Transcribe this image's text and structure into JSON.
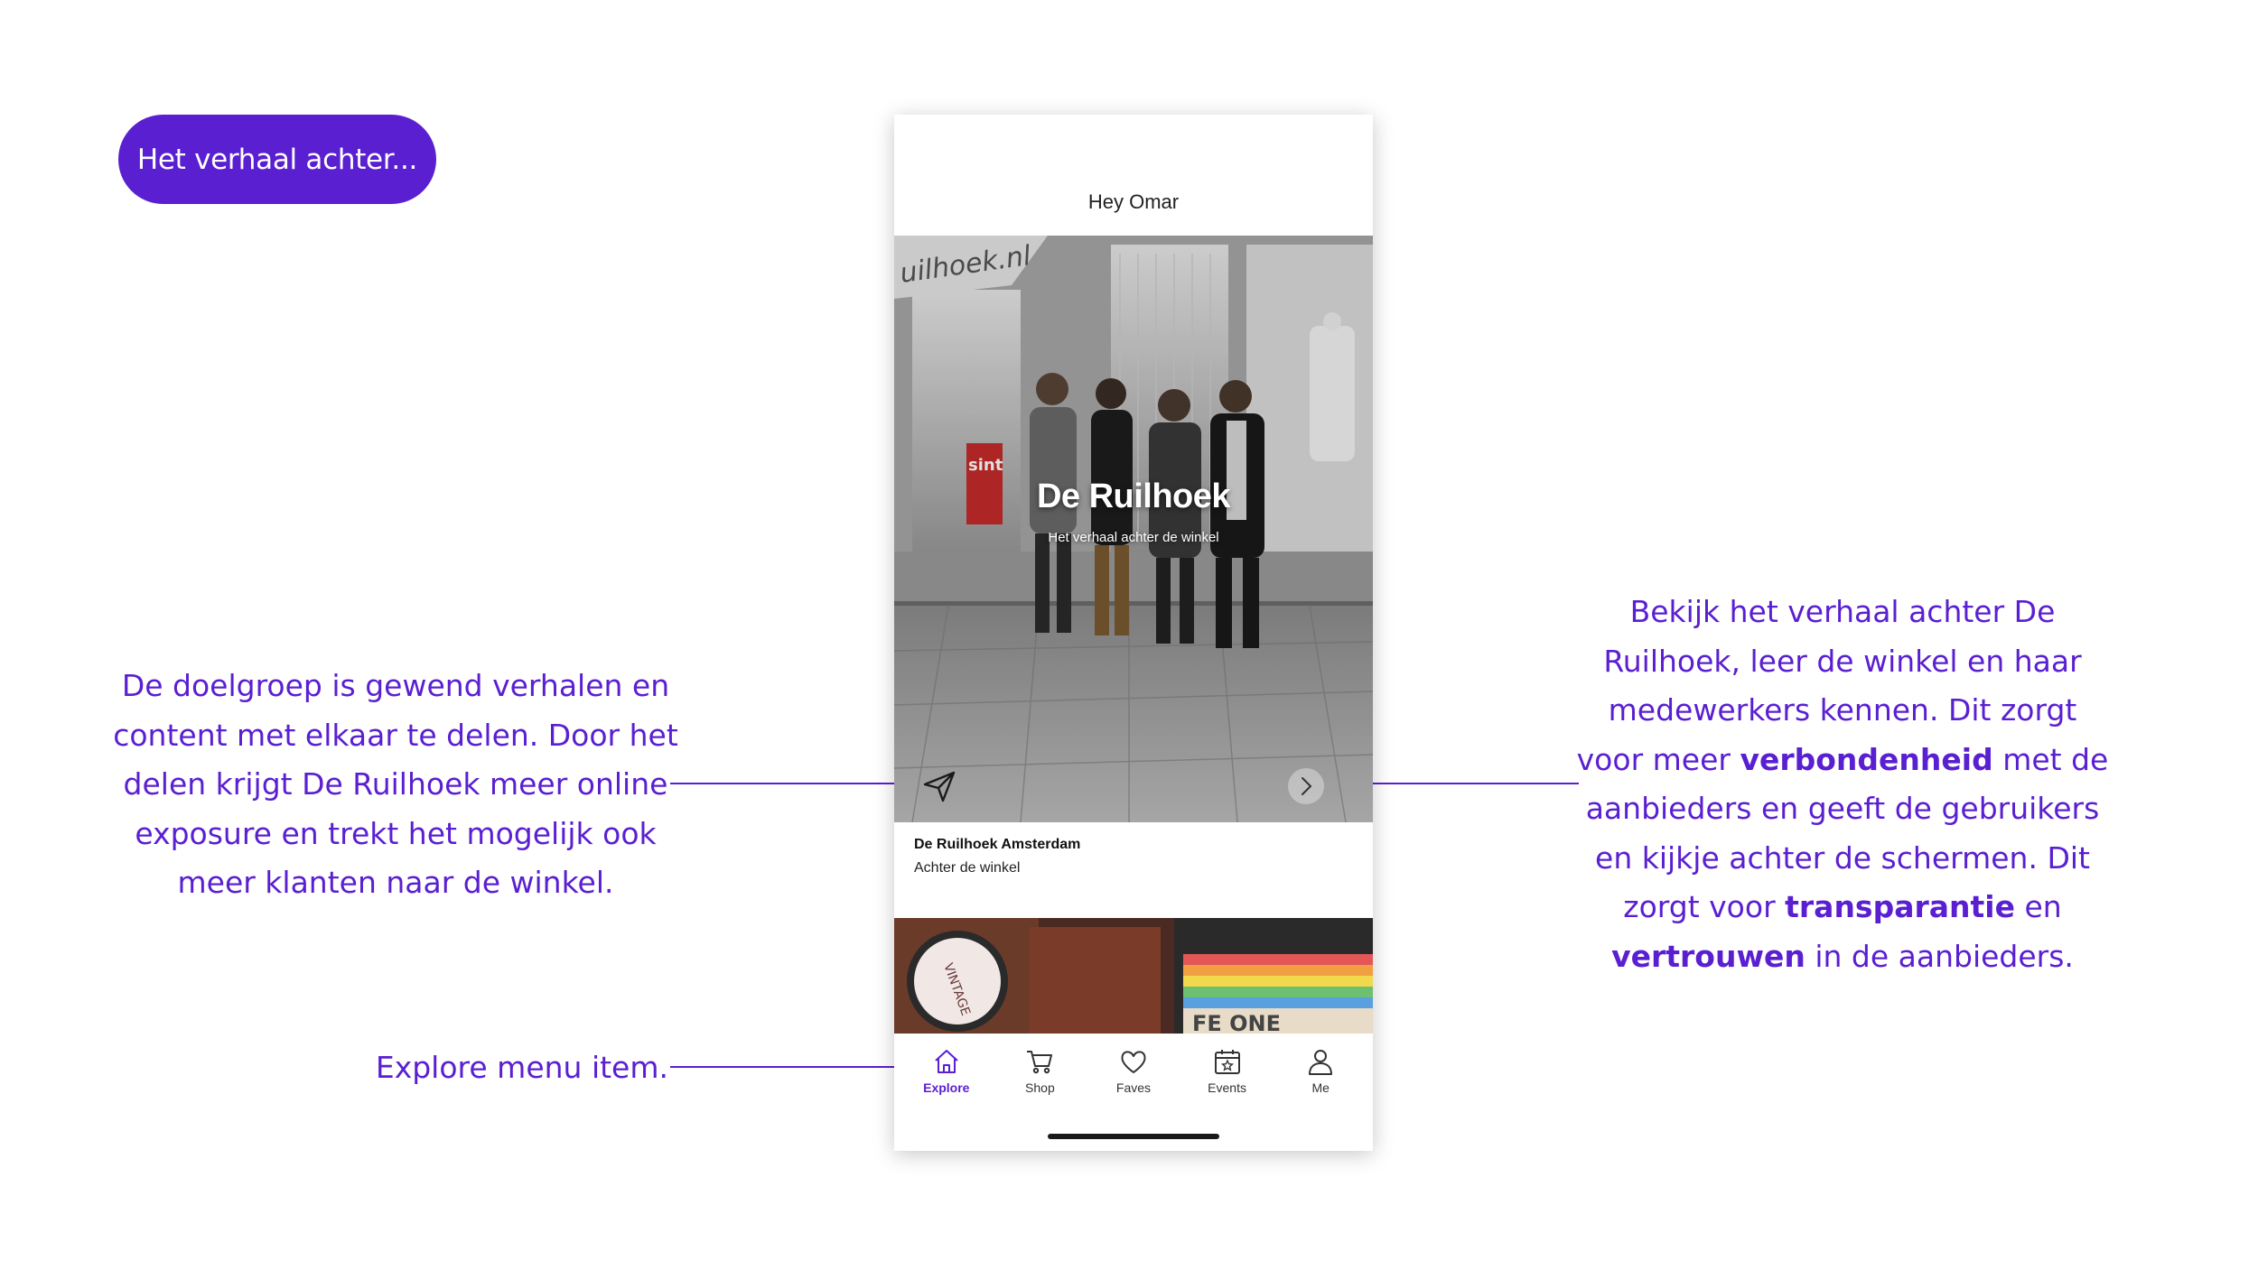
{
  "header_pill": {
    "label": "Het verhaal achter..."
  },
  "annotations": {
    "left": {
      "text": "De doelgroep is gewend verhalen en content met elkaar te delen. Door het delen krijgt De Ruilhoek meer online exposure en trekt het mogelijk ook meer klanten naar de winkel."
    },
    "right": {
      "part1": "Bekijk het verhaal achter De Ruilhoek, leer de winkel en haar medewerkers kennen. Dit zorgt voor meer ",
      "bold1": "verbondenheid",
      "part2": " met de aanbieders en geeft de gebruikers en kijkje achter de schermen. Dit zorgt voor ",
      "bold2": "transparantie",
      "part3": " en ",
      "bold3": "vertrouwen",
      "part4": " in de aanbieders."
    },
    "explore": {
      "text": "Explore menu item."
    }
  },
  "phone": {
    "greeting": "Hey Omar",
    "hero": {
      "title": "De Ruilhoek",
      "subtitle": "Het verhaal achter de winkel",
      "storefront_sign": "uilhoek.nl",
      "window_sticker": "sint"
    },
    "card": {
      "title": "De Ruilhoek Amsterdam",
      "subtitle": "Achter de winkel"
    },
    "second_card": {
      "sign_text": "VINTAGE",
      "shop_text": "FE ONE"
    },
    "tabs": [
      {
        "label": "Explore",
        "icon": "home-icon",
        "active": true
      },
      {
        "label": "Shop",
        "icon": "cart-icon",
        "active": false
      },
      {
        "label": "Faves",
        "icon": "heart-icon",
        "active": false
      },
      {
        "label": "Events",
        "icon": "calendar-icon",
        "active": false
      },
      {
        "label": "Me",
        "icon": "user-icon",
        "active": false
      }
    ]
  },
  "colors": {
    "accent": "#5a1fd1",
    "text_dark": "#111111"
  }
}
